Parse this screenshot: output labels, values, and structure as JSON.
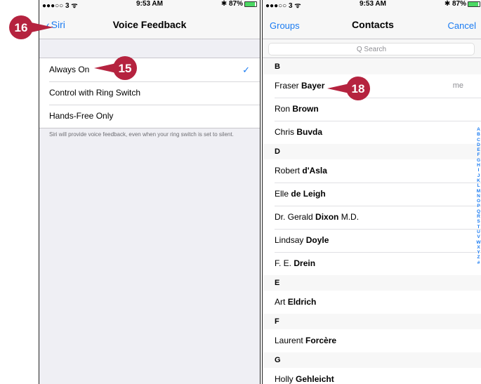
{
  "colors": {
    "accent": "#1a7bf2",
    "callout": "#b5233f",
    "battery": "#4cd964"
  },
  "left_phone": {
    "status": {
      "carrier": "●●●○○ 3 ᯤ",
      "time": "9:53 AM",
      "battery": "✱ 87%",
      "battery_level": 0.87
    },
    "nav": {
      "back_label": "Siri",
      "title": "Voice Feedback"
    },
    "options": [
      {
        "label": "Always On",
        "selected": true
      },
      {
        "label": "Control with Ring Switch",
        "selected": false
      },
      {
        "label": "Hands-Free Only",
        "selected": false
      }
    ],
    "check_glyph": "✓",
    "footer": "Siri will provide voice feedback, even when your ring switch is set to silent."
  },
  "right_phone": {
    "status": {
      "carrier": "●●●○○ 3 ᯤ",
      "time": "9:53 AM",
      "battery": "✱ 87%",
      "battery_level": 0.87
    },
    "nav": {
      "left": "Groups",
      "title": "Contacts",
      "right": "Cancel"
    },
    "search_placeholder": "Q Search",
    "sections": [
      {
        "letter": "B",
        "contacts": [
          {
            "first": "Fraser",
            "last": "Bayer",
            "suffix": "",
            "tag": "me"
          },
          {
            "first": "Ron",
            "last": "Brown",
            "suffix": "",
            "tag": ""
          },
          {
            "first": "Chris",
            "last": "Buvda",
            "suffix": "",
            "tag": ""
          }
        ]
      },
      {
        "letter": "D",
        "contacts": [
          {
            "first": "Robert",
            "last": "d'Asla",
            "suffix": "",
            "tag": ""
          },
          {
            "first": "Elle",
            "last": "de Leigh",
            "suffix": "",
            "tag": ""
          },
          {
            "first": "Dr. Gerald",
            "last": "Dixon",
            "suffix": "M.D.",
            "tag": ""
          },
          {
            "first": "Lindsay",
            "last": "Doyle",
            "suffix": "",
            "tag": ""
          },
          {
            "first": "F. E.",
            "last": "Drein",
            "suffix": "",
            "tag": ""
          }
        ]
      },
      {
        "letter": "E",
        "contacts": [
          {
            "first": "Art",
            "last": "Eldrich",
            "suffix": "",
            "tag": ""
          }
        ]
      },
      {
        "letter": "F",
        "contacts": [
          {
            "first": "Laurent",
            "last": "Forcère",
            "suffix": "",
            "tag": ""
          }
        ]
      },
      {
        "letter": "G",
        "contacts": [
          {
            "first": "Holly",
            "last": "Gehleicht",
            "suffix": "",
            "tag": ""
          }
        ]
      }
    ],
    "index_letters": [
      "A",
      "B",
      "C",
      "D",
      "E",
      "F",
      "G",
      "H",
      "I",
      "J",
      "K",
      "L",
      "M",
      "N",
      "O",
      "P",
      "Q",
      "R",
      "S",
      "T",
      "U",
      "V",
      "W",
      "X",
      "Y",
      "Z",
      "#"
    ]
  },
  "callouts": [
    "16",
    "15",
    "18"
  ]
}
